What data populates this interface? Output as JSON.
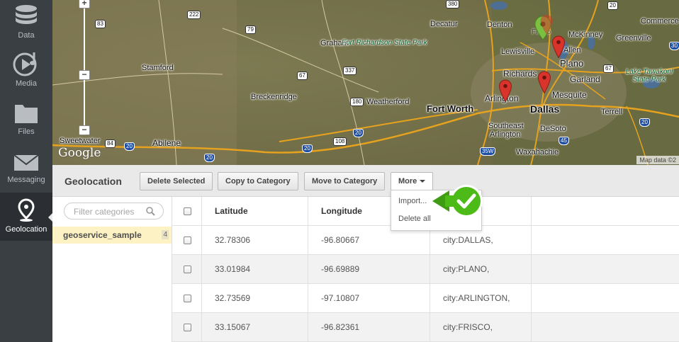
{
  "nav": {
    "items": [
      {
        "label": "Data",
        "icon": "database-icon"
      },
      {
        "label": "Media",
        "icon": "media-play-icon"
      },
      {
        "label": "Files",
        "icon": "folder-icon"
      },
      {
        "label": "Messaging",
        "icon": "envelope-icon"
      },
      {
        "label": "Geolocation",
        "icon": "map-pin-icon"
      }
    ]
  },
  "map": {
    "cities": {
      "denton": "Denton",
      "decatur": "Decatur",
      "mckinney": "McKinney",
      "greenville": "Greenville",
      "commerce": "Commerce",
      "lewisville": "Lewisville",
      "allen": "Allen",
      "plano": "Plano",
      "graham": "Graham",
      "stamford": "Stamford",
      "richardson": "Richards",
      "garland": "Garland",
      "arlington": "Arlington",
      "mesquite": "Mesquite",
      "breckenridge": "Breckenridge",
      "weatherford": "Weatherford",
      "fort_worth": "Fort Worth",
      "dallas": "Dallas",
      "terrell": "Terrell",
      "southeast_arlington_1": "Southeast",
      "southeast_arlington_2": "Arlington",
      "desoto": "DeSoto",
      "sweetwater": "Sweetwater",
      "abilene": "Abilene",
      "waxahachie": "Waxahachie",
      "frisco": "Frisco"
    },
    "parks": {
      "fort_richardson": "Fort Richardson State Park",
      "lake_tawakoni": "Lake Tawakoni State Park"
    },
    "shields": [
      "222",
      "83",
      "79",
      "67",
      "337",
      "380",
      "180",
      "20",
      "108",
      "20",
      "20",
      "20",
      "84",
      "20",
      "35W",
      "45",
      "67",
      "30",
      "20"
    ],
    "zoom": {
      "in": "+",
      "mid": "−",
      "out": "−"
    },
    "brand": "Google",
    "attribution": "Map data ©2"
  },
  "toolbar": {
    "title": "Geolocation",
    "delete_selected": "Delete Selected",
    "copy_to_category": "Copy to Category",
    "move_to_category": "Move to Category",
    "more": "More"
  },
  "dropdown": {
    "items": [
      "Import...",
      "Delete all"
    ]
  },
  "categories": {
    "search_placeholder": "Filter categories",
    "items": [
      {
        "name": "geoservice_sample",
        "count": "4"
      }
    ]
  },
  "table": {
    "headers": [
      "Latitude",
      "Longitude",
      ""
    ],
    "rows": [
      {
        "latitude": "32.78306",
        "longitude": "-96.80667",
        "meta": "city:DALLAS,"
      },
      {
        "latitude": "33.01984",
        "longitude": "-96.69889",
        "meta": "city:PLANO,"
      },
      {
        "latitude": "32.73569",
        "longitude": "-97.10807",
        "meta": "city:ARLINGTON,"
      },
      {
        "latitude": "33.15067",
        "longitude": "-96.82361",
        "meta": "city:FRISCO,"
      }
    ]
  },
  "colors": {
    "nav_bg": "#3a3f44",
    "category_highlight": "#fcf2c4",
    "callout_green": "#4cbb17",
    "pin_red": "#d9342b",
    "pin_green": "#7ac142"
  }
}
